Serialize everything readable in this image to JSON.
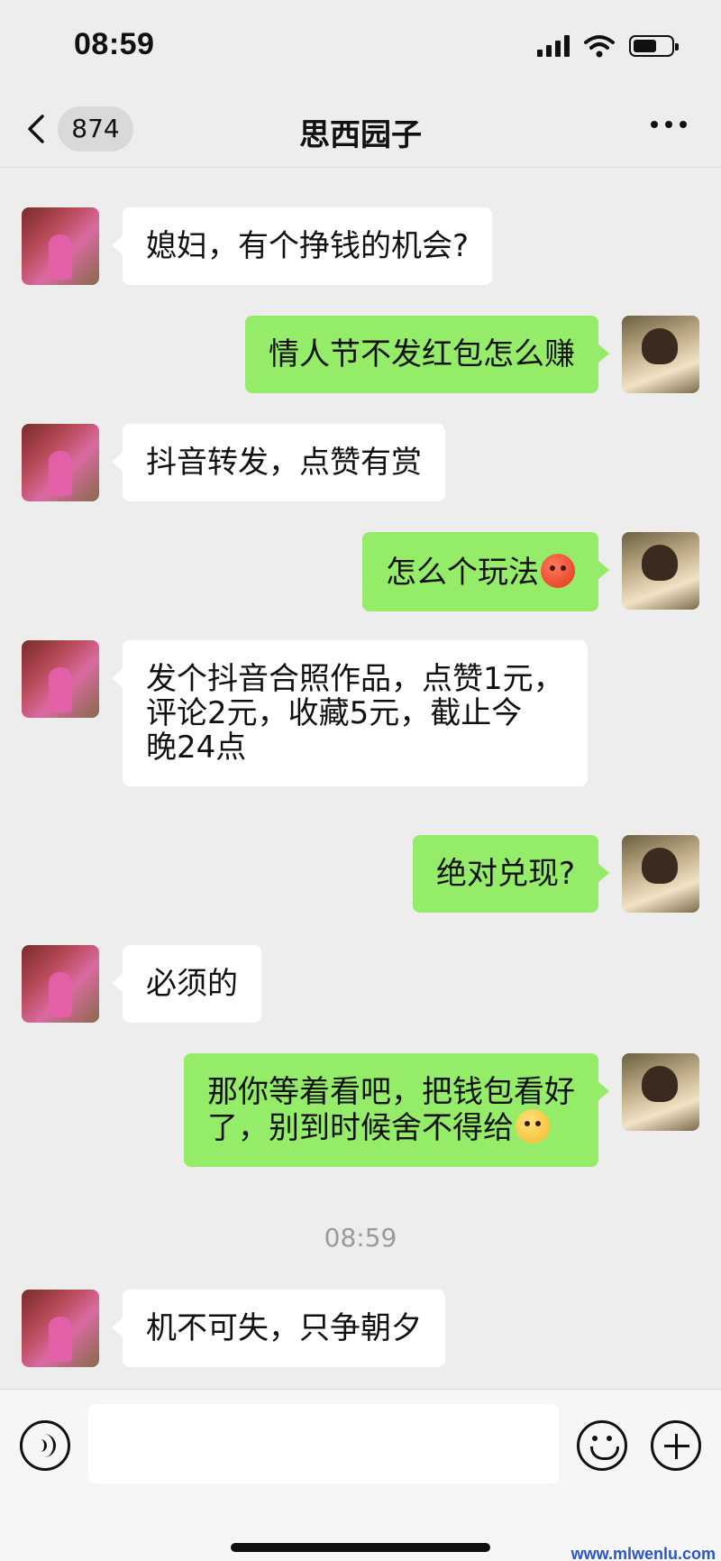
{
  "status_bar": {
    "time": "08:59"
  },
  "nav": {
    "back_label": "",
    "unread_count": "874",
    "title": "思西园子"
  },
  "messages": [
    {
      "sender": "other",
      "text": "媳妇，有个挣钱的机会?"
    },
    {
      "sender": "self",
      "text": "情人节不发红包怎么赚"
    },
    {
      "sender": "other",
      "text": "抖音转发，点赞有赏"
    },
    {
      "sender": "self",
      "text": "怎么个玩法",
      "emoji": "anxious-sweat-emoji"
    },
    {
      "sender": "other",
      "text": "发个抖音合照作品，点赞1元，\n评论2元，收藏5元，截止今\n晚24点"
    },
    {
      "sender": "self",
      "text": "绝对兑现?"
    },
    {
      "sender": "other",
      "text": "必须的"
    },
    {
      "sender": "self",
      "text": "那你等着看吧，把钱包看好\n了，别到时候舍不得给",
      "emoji": "hand-over-mouth-emoji"
    },
    {
      "sender": "other",
      "text": "机不可失，只争朝夕"
    }
  ],
  "timestamp": "08:59",
  "input": {
    "placeholder": ""
  },
  "watermark": "www.mlwenlu.com",
  "colors": {
    "self_bubble": "#95ec69",
    "other_bubble": "#ffffff",
    "background": "#ededed"
  }
}
